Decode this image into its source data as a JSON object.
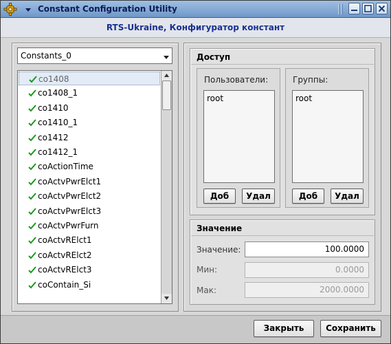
{
  "window": {
    "title": "Constant Configuration Utility",
    "icon": "gear-icon",
    "titlebar_color": "#7fa4d3"
  },
  "header": {
    "title": "RTS-Ukraine, Конфигуратор констант",
    "title_color": "#1a2f8e"
  },
  "constants_set": {
    "selected": "Constants_0"
  },
  "constants_list": {
    "items": [
      {
        "label": "co1408",
        "selected": true
      },
      {
        "label": "co1408_1"
      },
      {
        "label": "co1410"
      },
      {
        "label": "co1410_1"
      },
      {
        "label": "co1412"
      },
      {
        "label": "co1412_1"
      },
      {
        "label": "coActionTime"
      },
      {
        "label": "coActvPwrElct1"
      },
      {
        "label": "coActvPwrElct2"
      },
      {
        "label": "coActvPwrElct3"
      },
      {
        "label": "coActvPwrFurn"
      },
      {
        "label": "coActvRElct1"
      },
      {
        "label": "coActvRElct2"
      },
      {
        "label": "coActvRElct3"
      },
      {
        "label": "coContain_Si"
      }
    ],
    "item_icon": "checkmark-icon",
    "check_color": "#1a9a1a"
  },
  "access": {
    "title": "Доступ",
    "users": {
      "label": "Пользователи:",
      "items": [
        "root"
      ],
      "add_label": "Доб",
      "remove_label": "Удал"
    },
    "groups": {
      "label": "Группы:",
      "items": [
        "root"
      ],
      "add_label": "Доб",
      "remove_label": "Удал"
    }
  },
  "value": {
    "title": "Значение",
    "value_label": "Значение:",
    "value": "100.0000",
    "min_label": "Мин:",
    "min": "0.0000",
    "max_label": "Мак:",
    "max": "2000.0000"
  },
  "footer": {
    "close_label": "Закрыть",
    "save_label": "Сохранить"
  }
}
